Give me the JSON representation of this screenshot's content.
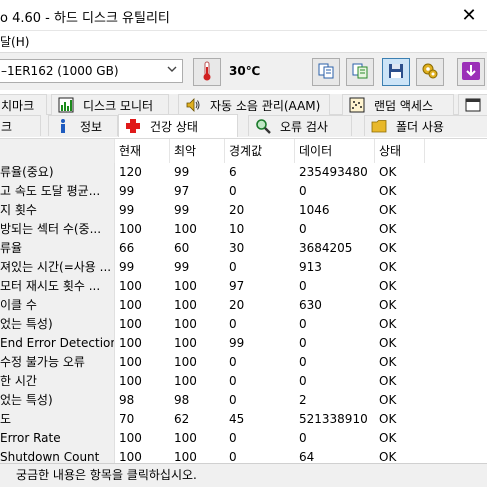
{
  "window": {
    "title": "o 4.60 - 하드 디스크 유틸리티",
    "close_glyph": "✕"
  },
  "menu": {
    "items": [
      "달(H)"
    ]
  },
  "toolbar": {
    "disk_selected": "–1ER162 (1000 GB)",
    "temperature": "30℃"
  },
  "tabs_row1": [
    {
      "label": "치마크",
      "icon": ""
    },
    {
      "label": "디스크 모니터",
      "icon": "bar-chart-icon"
    },
    {
      "label": "자동 소음 관리(AAM)",
      "icon": "speaker-icon"
    },
    {
      "label": "랜덤 액세스",
      "icon": "dots-grid-icon"
    },
    {
      "label": "",
      "icon": "window-icon"
    }
  ],
  "tabs_row2": [
    {
      "label": "크",
      "icon": ""
    },
    {
      "label": "정보",
      "icon": "info-icon"
    },
    {
      "label": "건강 상태",
      "icon": "red-cross-icon"
    },
    {
      "label": "오류 검사",
      "icon": "magnifier-icon"
    },
    {
      "label": "폴더 사용",
      "icon": "folder-icon"
    }
  ],
  "table": {
    "columns": [
      "",
      "현재",
      "최악",
      "경계값",
      "데이터",
      "상태"
    ],
    "rows": [
      [
        "류율(중요)",
        "120",
        "99",
        "6",
        "235493480",
        "OK"
      ],
      [
        "고 속도 도달 평균...",
        "99",
        "97",
        "0",
        "0",
        "OK"
      ],
      [
        "지 횟수",
        "99",
        "99",
        "20",
        "1046",
        "OK"
      ],
      [
        "방되는 섹터 수(중...",
        "100",
        "100",
        "10",
        "0",
        "OK"
      ],
      [
        "류율",
        "66",
        "60",
        "30",
        "3684205",
        "OK"
      ],
      [
        "져있는 시간(=사용 ...",
        "99",
        "99",
        "0",
        "913",
        "OK"
      ],
      [
        "모터 재시도 횟수  ...",
        "100",
        "100",
        "97",
        "0",
        "OK"
      ],
      [
        "이클 수",
        "100",
        "100",
        "20",
        "630",
        "OK"
      ],
      [
        "었는 특성)",
        "100",
        "100",
        "0",
        "0",
        "OK"
      ],
      [
        "End Error Detection...",
        "100",
        "100",
        "99",
        "0",
        "OK"
      ],
      [
        "수정 불가능 오류",
        "100",
        "100",
        "0",
        "0",
        "OK"
      ],
      [
        "한 시간",
        "100",
        "100",
        "0",
        "0",
        "OK"
      ],
      [
        "었는 특성)",
        "98",
        "98",
        "0",
        "2",
        "OK"
      ],
      [
        "도",
        "70",
        "62",
        "45",
        "521338910",
        "OK"
      ],
      [
        "Error Rate",
        "100",
        "100",
        "0",
        "0",
        "OK"
      ],
      [
        "Shutdown Count",
        "100",
        "100",
        "0",
        "64",
        "OK"
      ]
    ]
  },
  "statusbar": {
    "text": "궁금한 내용은 항목을 클릭하십시오."
  },
  "colors": {
    "accent": "#0078d7",
    "tab_bg": "#f0f0f0",
    "name_col_bg": "#f0f0f0"
  }
}
